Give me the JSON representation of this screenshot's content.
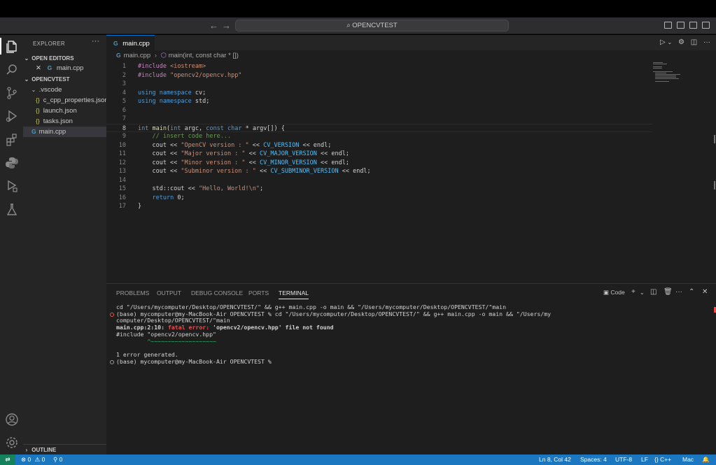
{
  "titlebar": {
    "title": "OPENCVTEST"
  },
  "sidebar": {
    "title": "EXPLORER",
    "more": "···",
    "open_editors_label": "OPEN EDITORS",
    "open_editor_file": "main.cpp",
    "project_label": "OPENCVTEST",
    "folder": ".vscode",
    "folder_files": [
      "c_cpp_properties.json",
      "launch.json",
      "tasks.json"
    ],
    "root_file": "main.cpp",
    "outline_label": "OUTLINE"
  },
  "editor": {
    "tab_label": "main.cpp",
    "breadcrumb_file": "main.cpp",
    "breadcrumb_symbol": "main(int, const char * [])",
    "lines": [
      "#include <iostream>",
      "#include \"opencv2/opencv.hpp\"",
      "",
      "using namespace cv;",
      "using namespace std;",
      "",
      "",
      "int main(int argc, const char * argv[]) {",
      "    // insert code here...",
      "    cout << \"OpenCV version : \" << CV_VERSION << endl;",
      "    cout << \"Major version : \" << CV_MAJOR_VERSION << endl;",
      "    cout << \"Minor version : \" << CV_MINOR_VERSION << endl;",
      "    cout << \"Subminor version : \" << CV_SUBMINOR_VERSION << endl;",
      "",
      "    std::cout << \"Hello, World!\\n\";",
      "    return 0;",
      "}"
    ],
    "current_line": 8
  },
  "panel": {
    "tabs": [
      "PROBLEMS",
      "OUTPUT",
      "DEBUG CONSOLE",
      "PORTS",
      "TERMINAL"
    ],
    "active_tab": "TERMINAL",
    "shell_label": "Code",
    "terminal_lines": [
      "cd \"/Users/mycomputer/Desktop/OPENCVTEST/\" && g++ main.cpp -o main && \"/Users/mycomputer/Desktop/OPENCVTEST/\"main",
      "(base) mycomputer@my-MacBook-Air OPENCVTEST % cd \"/Users/mycomputer/Desktop/OPENCVTEST/\" && g++ main.cpp -o main && \"/Users/my",
      "computer/Desktop/OPENCVTEST/\"main",
      "main.cpp:2:10: fatal error: 'opencv2/opencv.hpp' file not found",
      "#include \"opencv2/opencv.hpp\"",
      "         ^~~~~~~~~~~~~~~~~~~~",
      "1 error generated.",
      "(base) mycomputer@my-MacBook-Air OPENCVTEST % "
    ]
  },
  "statusbar": {
    "errors": "0",
    "warnings": "0",
    "ports": "0",
    "position": "Ln 8, Col 42",
    "spaces": "Spaces: 4",
    "encoding": "UTF-8",
    "eol": "LF",
    "language": "C++",
    "platform": "Mac"
  },
  "colors": {
    "accent": "#1b78c0",
    "remote": "#16825d",
    "error": "#f14c4c",
    "keyword": "#569cd6",
    "string": "#ce9178",
    "comment": "#6a9955"
  }
}
